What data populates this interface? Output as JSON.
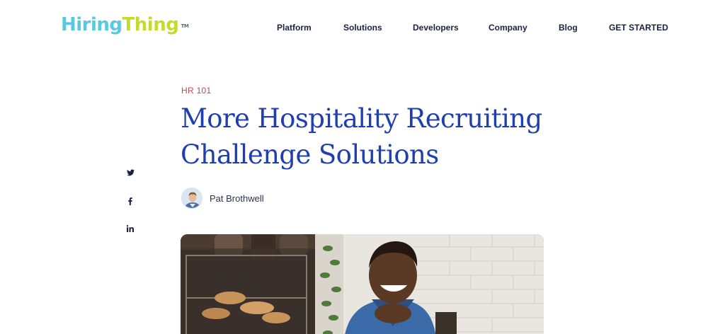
{
  "brand": {
    "part1": "Hiring",
    "part2": "Thing",
    "tm": "TM"
  },
  "nav": [
    {
      "label": "Platform"
    },
    {
      "label": "Solutions"
    },
    {
      "label": "Developers"
    },
    {
      "label": "Company"
    },
    {
      "label": "Blog"
    },
    {
      "label": "GET STARTED"
    }
  ],
  "share": [
    {
      "icon": "twitter-icon"
    },
    {
      "icon": "facebook-icon"
    },
    {
      "icon": "linkedin-icon"
    }
  ],
  "article": {
    "category": "HR 101",
    "title": "More Hospitality Recruiting Challenge Solutions",
    "author": "Pat Brothwell"
  },
  "colors": {
    "brand_blue": "#5ac8e0",
    "brand_green": "#c6d92e",
    "title_blue": "#1f3fb0",
    "category_red": "#c04848",
    "nav_text": "#1b2240"
  }
}
